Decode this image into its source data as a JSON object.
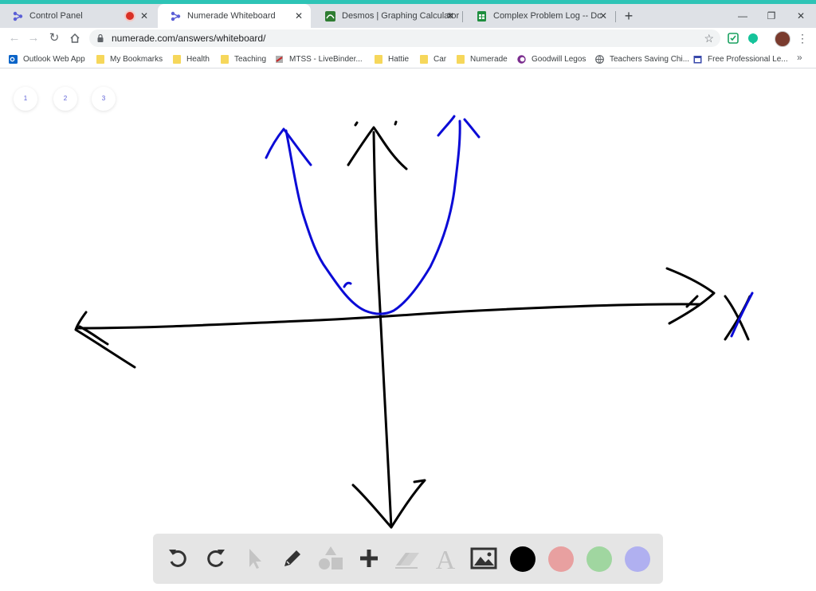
{
  "browser": {
    "tabs": [
      {
        "title": "Control Panel",
        "favicon": "numerade-icon",
        "active": false,
        "recording": true
      },
      {
        "title": "Numerade Whiteboard",
        "favicon": "numerade-icon",
        "active": true,
        "recording": false
      },
      {
        "title": "Desmos | Graphing Calculator",
        "favicon": "desmos-icon",
        "active": false,
        "recording": false
      },
      {
        "title": "Complex Problem Log -- Donald",
        "favicon": "sheets-icon",
        "active": false,
        "recording": false
      }
    ],
    "url": "numerade.com/answers/whiteboard/",
    "bookmarks": [
      {
        "label": "Outlook Web App",
        "icon": "outlook-icon"
      },
      {
        "label": "My Bookmarks",
        "icon": "folder-icon"
      },
      {
        "label": "Health",
        "icon": "folder-icon"
      },
      {
        "label": "Teaching",
        "icon": "folder-icon"
      },
      {
        "label": "MTSS - LiveBinder...",
        "icon": "livebinder-icon"
      },
      {
        "label": "Hattie",
        "icon": "folder-icon"
      },
      {
        "label": "Car",
        "icon": "folder-icon"
      },
      {
        "label": "Numerade",
        "icon": "folder-icon"
      },
      {
        "label": "Goodwill Legos",
        "icon": "goodwill-icon"
      },
      {
        "label": "Teachers Saving Chi...",
        "icon": "globe-icon"
      },
      {
        "label": "Free Professional Le...",
        "icon": "calendar-icon"
      }
    ]
  },
  "whiteboard": {
    "pages": [
      "1",
      "2",
      "3"
    ],
    "tools": [
      {
        "name": "undo-icon",
        "enabled": true
      },
      {
        "name": "redo-icon",
        "enabled": true
      },
      {
        "name": "pointer-icon",
        "enabled": false
      },
      {
        "name": "pencil-icon",
        "enabled": true
      },
      {
        "name": "shapes-icon",
        "enabled": false
      },
      {
        "name": "plus-icon",
        "enabled": true
      },
      {
        "name": "eraser-icon",
        "enabled": false
      },
      {
        "name": "text-icon",
        "enabled": false
      },
      {
        "name": "image-icon",
        "enabled": true
      }
    ],
    "colors": [
      "#000000",
      "#e8a0a0",
      "#a0d6a0",
      "#b0b0f0"
    ],
    "ink_colors": {
      "black": "#000000",
      "blue": "#0b0bd6"
    }
  },
  "theme": {
    "accent": "#2ec4b6",
    "page_tab_text": "#5b5fd6"
  }
}
